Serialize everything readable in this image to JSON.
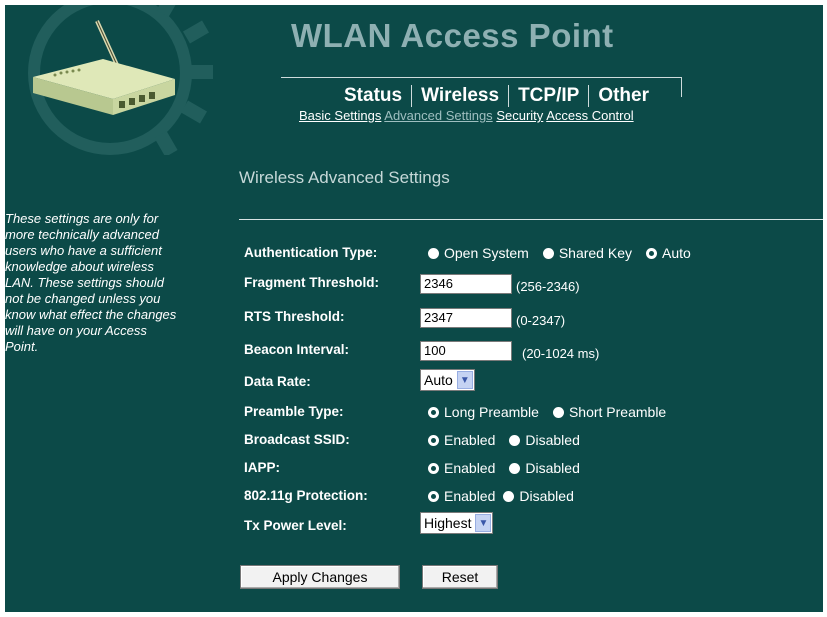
{
  "header": {
    "title": "WLAN Access Point",
    "main_nav": [
      "Status",
      "Wireless",
      "TCP/IP",
      "Other"
    ],
    "sub_nav": [
      {
        "label": "Basic Settings",
        "active": false
      },
      {
        "label": "Advanced Settings",
        "active": true
      },
      {
        "label": "Security",
        "active": false
      },
      {
        "label": "Access Control",
        "active": false
      }
    ]
  },
  "sidebar": {
    "help_text": "These settings are only for more technically advanced users who have a sufficient knowledge about wireless LAN. These settings should not be changed unless you know what effect the changes will have on your Access Point."
  },
  "page": {
    "title": "Wireless Advanced Settings"
  },
  "form": {
    "auth_type": {
      "label": "Authentication Type:",
      "options": [
        "Open System",
        "Shared Key",
        "Auto"
      ],
      "selected": "Auto"
    },
    "fragment": {
      "label": "Fragment Threshold:",
      "value": "2346",
      "range": "(256-2346)"
    },
    "rts": {
      "label": "RTS Threshold:",
      "value": "2347",
      "range": "(0-2347)"
    },
    "beacon": {
      "label": "Beacon Interval:",
      "value": "100",
      "range": "(20-1024 ms)"
    },
    "data_rate": {
      "label": "Data Rate:",
      "value": "Auto"
    },
    "preamble": {
      "label": "Preamble Type:",
      "options": [
        "Long Preamble",
        "Short Preamble"
      ],
      "selected": "Long Preamble"
    },
    "broadcast_ssid": {
      "label": "Broadcast SSID:",
      "options": [
        "Enabled",
        "Disabled"
      ],
      "selected": "Enabled"
    },
    "iapp": {
      "label": "IAPP:",
      "options": [
        "Enabled",
        "Disabled"
      ],
      "selected": "Enabled"
    },
    "protection": {
      "label": "802.11g Protection:",
      "options": [
        "Enabled",
        "Disabled"
      ],
      "selected": "Enabled"
    },
    "tx_power": {
      "label": "Tx Power Level:",
      "value": "Highest"
    }
  },
  "buttons": {
    "apply": "Apply Changes",
    "reset": "Reset"
  },
  "colors": {
    "background": "#0c4a48",
    "title": "#8eb0b2"
  }
}
